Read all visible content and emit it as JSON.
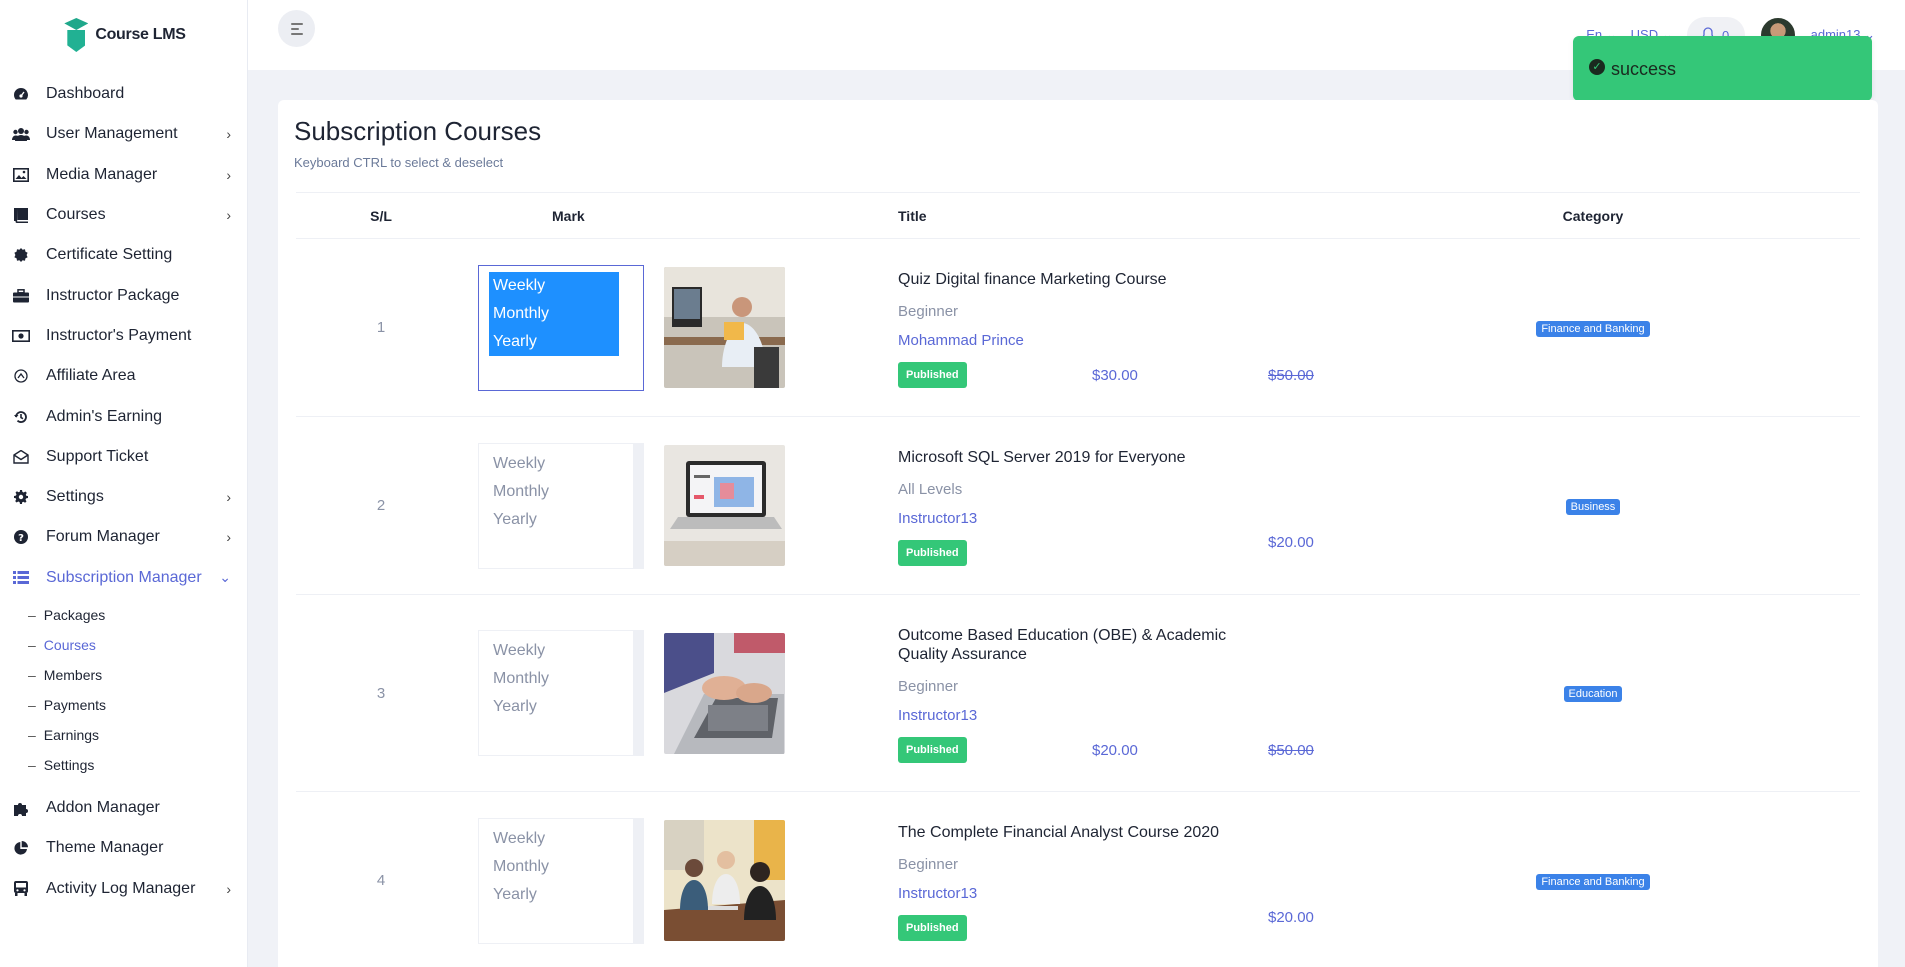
{
  "app": {
    "logo_text": "Course LMS"
  },
  "sidebar": {
    "items": [
      {
        "label": "Dashboard",
        "icon": "dashboard-icon",
        "has_children": false
      },
      {
        "label": "User Management",
        "icon": "users-icon",
        "has_children": true
      },
      {
        "label": "Media Manager",
        "icon": "image-icon",
        "has_children": true
      },
      {
        "label": "Courses",
        "icon": "book-icon",
        "has_children": true
      },
      {
        "label": "Certificate Setting",
        "icon": "certificate-icon",
        "has_children": false
      },
      {
        "label": "Instructor Package",
        "icon": "briefcase-icon",
        "has_children": false
      },
      {
        "label": "Instructor's Payment",
        "icon": "money-icon",
        "has_children": false
      },
      {
        "label": "Affiliate Area",
        "icon": "affiliate-icon",
        "has_children": false
      },
      {
        "label": "Admin's Earning",
        "icon": "history-icon",
        "has_children": false
      },
      {
        "label": "Support Ticket",
        "icon": "envelope-icon",
        "has_children": false
      },
      {
        "label": "Settings",
        "icon": "gear-icon",
        "has_children": true
      },
      {
        "label": "Forum Manager",
        "icon": "question-icon",
        "has_children": true
      },
      {
        "label": "Subscription Manager",
        "icon": "list-icon",
        "has_children": true,
        "active": true
      }
    ],
    "subscription_sub": [
      {
        "label": "Packages"
      },
      {
        "label": "Courses",
        "active": true
      },
      {
        "label": "Members"
      },
      {
        "label": "Payments"
      },
      {
        "label": "Earnings"
      },
      {
        "label": "Settings"
      }
    ],
    "items_after": [
      {
        "label": "Addon Manager",
        "icon": "puzzle-icon",
        "has_children": false
      },
      {
        "label": "Theme Manager",
        "icon": "pie-icon",
        "has_children": false
      },
      {
        "label": "Activity Log Manager",
        "icon": "bus-icon",
        "has_children": true
      }
    ]
  },
  "topbar": {
    "language": "En",
    "currency": "USD",
    "notification_count": "0",
    "user_name": "admin13"
  },
  "toast": {
    "message": "success"
  },
  "page": {
    "title": "Subscription Courses",
    "subtitle": "Keyboard CTRL to select & deselect"
  },
  "table": {
    "headers": {
      "sl": "S/L",
      "mark": "Mark",
      "title": "Title",
      "category": "Category"
    },
    "options": [
      "Weekly",
      "Monthly",
      "Yearly"
    ],
    "rows": [
      {
        "sl": "1",
        "selected": true,
        "title": "Quiz Digital finance Marketing Course",
        "level": "Beginner",
        "instructor": "Mohammad Prince",
        "status": "Published",
        "price": "$30.00",
        "old_price": "$50.00",
        "category": "Finance and Banking",
        "image": "man-at-desk"
      },
      {
        "sl": "2",
        "selected": false,
        "title": "Microsoft SQL Server 2019 for Everyone",
        "level": "All Levels",
        "instructor": "Instructor13",
        "status": "Published",
        "price": "",
        "old_price": "$20.00",
        "category": "Business",
        "image": "laptop-screen"
      },
      {
        "sl": "3",
        "selected": false,
        "title": "Outcome Based Education (OBE) & Academic Quality Assurance",
        "level": "Beginner",
        "instructor": "Instructor13",
        "status": "Published",
        "price": "$20.00",
        "old_price": "$50.00",
        "category": "Education",
        "image": "typing-hands"
      },
      {
        "sl": "4",
        "selected": false,
        "title": "The Complete Financial Analyst Course 2020",
        "level": "Beginner",
        "instructor": "Instructor13",
        "status": "Published",
        "price": "",
        "old_price": "$20.00",
        "category": "Finance and Banking",
        "image": "team-meeting"
      }
    ]
  }
}
